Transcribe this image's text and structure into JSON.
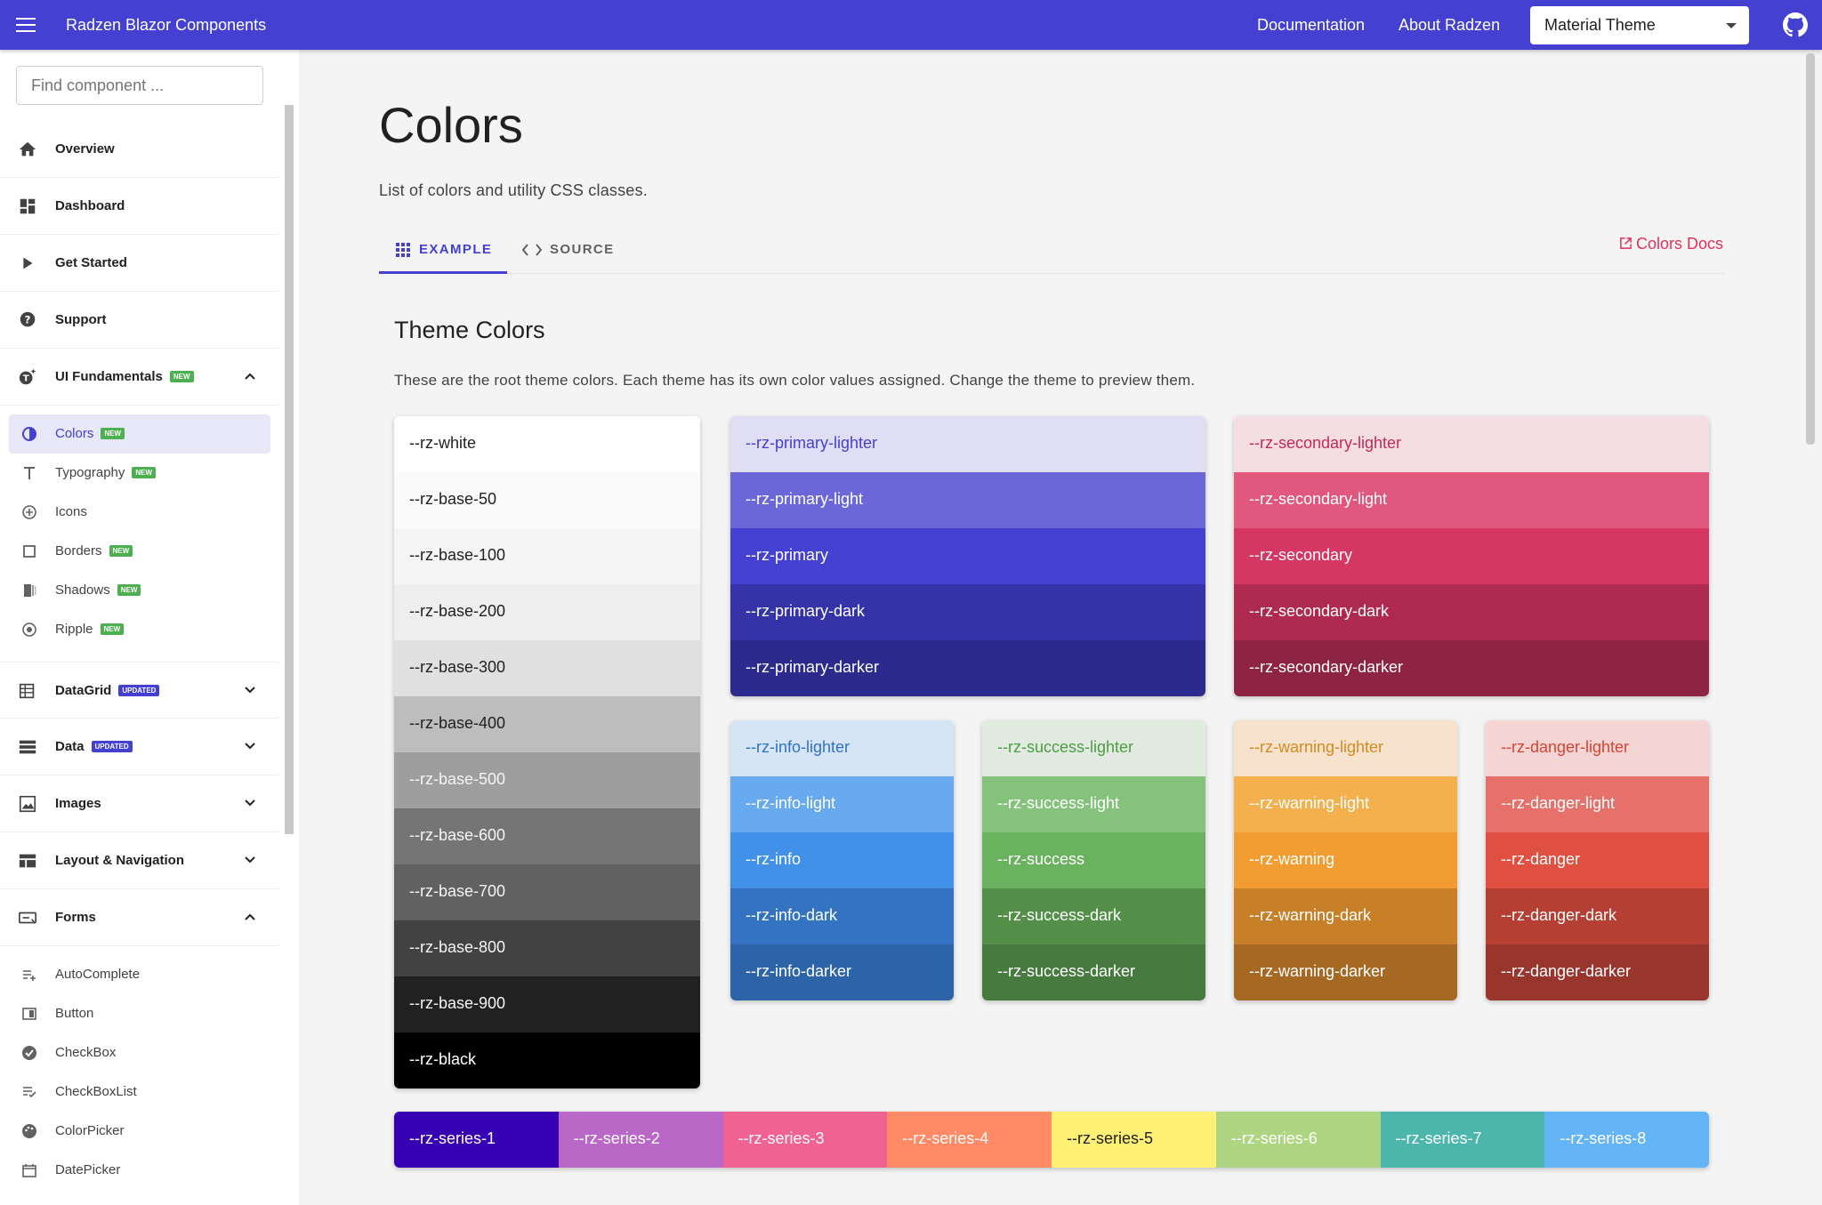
{
  "header": {
    "app_title": "Radzen Blazor Components",
    "links": [
      "Documentation",
      "About Radzen"
    ],
    "theme_select": "Material Theme"
  },
  "sidebar": {
    "search_placeholder": "Find component ...",
    "top_items": [
      {
        "label": "Overview",
        "icon": "home-icon"
      },
      {
        "label": "Dashboard",
        "icon": "dashboard-icon"
      },
      {
        "label": "Get Started",
        "icon": "play-icon"
      },
      {
        "label": "Support",
        "icon": "support-icon"
      }
    ],
    "ui_fundamentals": {
      "label": "UI Fundamentals",
      "badge": "NEW",
      "expanded": true
    },
    "ui_sub": [
      {
        "label": "Colors",
        "badge": "NEW",
        "icon": "contrast-icon",
        "active": true
      },
      {
        "label": "Typography",
        "badge": "NEW",
        "icon": "text-icon"
      },
      {
        "label": "Icons",
        "badge": "",
        "icon": "plus-circle-icon"
      },
      {
        "label": "Borders",
        "badge": "NEW",
        "icon": "square-outline-icon"
      },
      {
        "label": "Shadows",
        "badge": "NEW",
        "icon": "shadow-icon"
      },
      {
        "label": "Ripple",
        "badge": "NEW",
        "icon": "radio-dot-icon"
      }
    ],
    "groups": [
      {
        "label": "DataGrid",
        "badge": "UPDATED",
        "icon": "grid-icon"
      },
      {
        "label": "Data",
        "badge": "UPDATED",
        "icon": "list-icon"
      },
      {
        "label": "Images",
        "badge": "",
        "icon": "image-icon"
      },
      {
        "label": "Layout & Navigation",
        "badge": "",
        "icon": "layout-icon"
      },
      {
        "label": "Forms",
        "badge": "",
        "icon": "keyboard-icon"
      }
    ],
    "forms_sub": [
      {
        "label": "AutoComplete",
        "icon": "autocomplete-icon"
      },
      {
        "label": "Button",
        "icon": "button-icon"
      },
      {
        "label": "CheckBox",
        "icon": "check-circle-icon"
      },
      {
        "label": "CheckBoxList",
        "icon": "checklist-icon"
      },
      {
        "label": "ColorPicker",
        "icon": "palette-icon"
      },
      {
        "label": "DatePicker",
        "icon": "calendar-icon"
      }
    ]
  },
  "main": {
    "title": "Colors",
    "description": "List of colors and utility CSS classes.",
    "tabs": [
      {
        "label": "EXAMPLE",
        "active": true
      },
      {
        "label": "SOURCE",
        "active": false
      }
    ],
    "docs_link": "Colors Docs",
    "section_title": "Theme Colors",
    "section_desc": "These are the root theme colors. Each theme has its own color values assigned. Change the theme to preview them."
  },
  "palettes": {
    "base": [
      {
        "name": "--rz-white",
        "bg": "#ffffff",
        "fg": "#212121"
      },
      {
        "name": "--rz-base-50",
        "bg": "#fafafa",
        "fg": "#212121"
      },
      {
        "name": "--rz-base-100",
        "bg": "#f5f5f5",
        "fg": "#212121"
      },
      {
        "name": "--rz-base-200",
        "bg": "#eeeeee",
        "fg": "#212121"
      },
      {
        "name": "--rz-base-300",
        "bg": "#e0e0e0",
        "fg": "#212121"
      },
      {
        "name": "--rz-base-400",
        "bg": "#bdbdbd",
        "fg": "#212121"
      },
      {
        "name": "--rz-base-500",
        "bg": "#9e9e9e",
        "fg": "#f5f5f5"
      },
      {
        "name": "--rz-base-600",
        "bg": "#757575",
        "fg": "#f5f5f5"
      },
      {
        "name": "--rz-base-700",
        "bg": "#616161",
        "fg": "#f5f5f5"
      },
      {
        "name": "--rz-base-800",
        "bg": "#424242",
        "fg": "#f5f5f5"
      },
      {
        "name": "--rz-base-900",
        "bg": "#212121",
        "fg": "#f5f5f5"
      },
      {
        "name": "--rz-black",
        "bg": "#000000",
        "fg": "#ffffff"
      }
    ],
    "primary": [
      {
        "name": "--rz-primary-lighter",
        "bg": "#e0def5",
        "fg": "#4340d2"
      },
      {
        "name": "--rz-primary-light",
        "bg": "#6b67d9",
        "fg": "#ffffff"
      },
      {
        "name": "--rz-primary",
        "bg": "#4340d2",
        "fg": "#ffffff"
      },
      {
        "name": "--rz-primary-dark",
        "bg": "#3633a8",
        "fg": "#ffffff"
      },
      {
        "name": "--rz-primary-darker",
        "bg": "#2c2a8c",
        "fg": "#ffffff"
      }
    ],
    "secondary": [
      {
        "name": "--rz-secondary-lighter",
        "bg": "#f4dde3",
        "fg": "#c22a5c"
      },
      {
        "name": "--rz-secondary-light",
        "bg": "#e0587e",
        "fg": "#ffffff"
      },
      {
        "name": "--rz-secondary",
        "bg": "#d63762",
        "fg": "#ffffff"
      },
      {
        "name": "--rz-secondary-dark",
        "bg": "#ae2a4f",
        "fg": "#ffffff"
      },
      {
        "name": "--rz-secondary-darker",
        "bg": "#8e2443",
        "fg": "#ffffff"
      }
    ],
    "info": [
      {
        "name": "--rz-info-lighter",
        "bg": "#d6e5f6",
        "fg": "#2f71c6"
      },
      {
        "name": "--rz-info-light",
        "bg": "#68aaef",
        "fg": "#ffffff"
      },
      {
        "name": "--rz-info",
        "bg": "#4191e8",
        "fg": "#ffffff"
      },
      {
        "name": "--rz-info-dark",
        "bg": "#3373c2",
        "fg": "#ffffff"
      },
      {
        "name": "--rz-info-darker",
        "bg": "#2d64a8",
        "fg": "#ffffff"
      }
    ],
    "success": [
      {
        "name": "--rz-success-lighter",
        "bg": "#e1ebdf",
        "fg": "#4e9c45"
      },
      {
        "name": "--rz-success-light",
        "bg": "#85c27b",
        "fg": "#ffffff"
      },
      {
        "name": "--rz-success",
        "bg": "#6bb260",
        "fg": "#ffffff"
      },
      {
        "name": "--rz-success-dark",
        "bg": "#538f49",
        "fg": "#ffffff"
      },
      {
        "name": "--rz-success-darker",
        "bg": "#477a3e",
        "fg": "#ffffff"
      }
    ],
    "warning": [
      {
        "name": "--rz-warning-lighter",
        "bg": "#f7e3cd",
        "fg": "#d58a20"
      },
      {
        "name": "--rz-warning-light",
        "bg": "#f5b04e",
        "fg": "#ffffff"
      },
      {
        "name": "--rz-warning",
        "bg": "#f29d32",
        "fg": "#ffffff"
      },
      {
        "name": "--rz-warning-dark",
        "bg": "#c77f28",
        "fg": "#ffffff"
      },
      {
        "name": "--rz-warning-darker",
        "bg": "#a66923",
        "fg": "#ffffff"
      }
    ],
    "danger": [
      {
        "name": "--rz-danger-lighter",
        "bg": "#f4d5d3",
        "fg": "#d54436"
      },
      {
        "name": "--rz-danger-light",
        "bg": "#e6706a",
        "fg": "#ffffff"
      },
      {
        "name": "--rz-danger",
        "bg": "#e05040",
        "fg": "#ffffff"
      },
      {
        "name": "--rz-danger-dark",
        "bg": "#b53f33",
        "fg": "#ffffff"
      },
      {
        "name": "--rz-danger-darker",
        "bg": "#98362d",
        "fg": "#ffffff"
      }
    ],
    "series": [
      {
        "name": "--rz-series-1",
        "bg": "#3700b3",
        "fg": "#ffffff"
      },
      {
        "name": "--rz-series-2",
        "bg": "#ba68c8",
        "fg": "#ffffff"
      },
      {
        "name": "--rz-series-3",
        "bg": "#f06292",
        "fg": "#ffffff"
      },
      {
        "name": "--rz-series-4",
        "bg": "#ff8a65",
        "fg": "#ffffff"
      },
      {
        "name": "--rz-series-5",
        "bg": "#fff176",
        "fg": "#212121"
      },
      {
        "name": "--rz-series-6",
        "bg": "#aed581",
        "fg": "#ffffff"
      },
      {
        "name": "--rz-series-7",
        "bg": "#4db6ac",
        "fg": "#ffffff"
      },
      {
        "name": "--rz-series-8",
        "bg": "#64b5f6",
        "fg": "#ffffff"
      }
    ]
  },
  "colors": {
    "header_bg": "#4340d2",
    "accent": "#4340d2",
    "docs_link": "#e0315e",
    "new_badge": "#4caf50"
  }
}
